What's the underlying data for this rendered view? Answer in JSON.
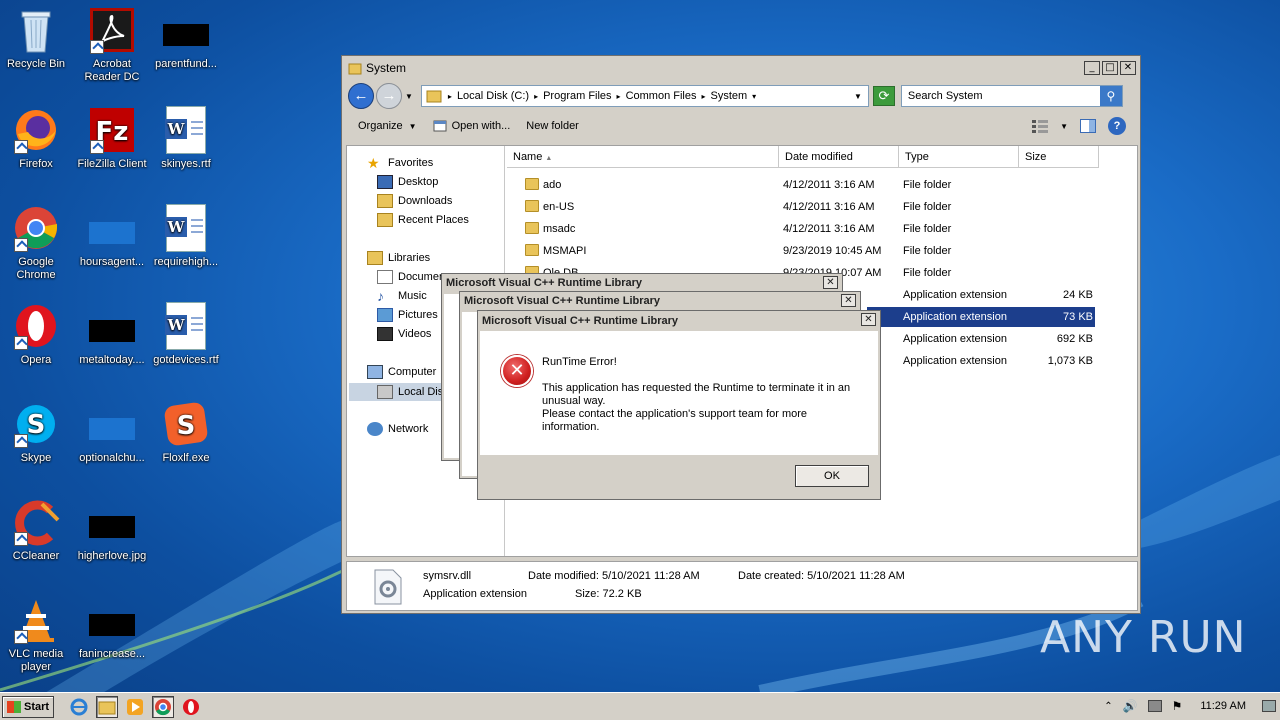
{
  "desktop": {
    "icons": [
      {
        "label": "Recycle Bin"
      },
      {
        "label": "Acrobat Reader DC"
      },
      {
        "label": "parentfund..."
      },
      {
        "label": "Firefox"
      },
      {
        "label": "FileZilla Client"
      },
      {
        "label": "skinyes.rtf"
      },
      {
        "label": "Google Chrome"
      },
      {
        "label": "hoursagent..."
      },
      {
        "label": "requirehigh..."
      },
      {
        "label": "Opera"
      },
      {
        "label": "metaltoday...."
      },
      {
        "label": "gotdevices.rtf"
      },
      {
        "label": "Skype"
      },
      {
        "label": "optionalchu..."
      },
      {
        "label": "Floxlf.exe"
      },
      {
        "label": "CCleaner"
      },
      {
        "label": "higherlove.jpg"
      },
      {
        "label": "VLC media player"
      },
      {
        "label": "fanincrease..."
      }
    ]
  },
  "explorer": {
    "title": "System",
    "breadcrumb": [
      "Local Disk (C:)",
      "Program Files",
      "Common Files",
      "System"
    ],
    "search_placeholder": "Search System",
    "toolbar": {
      "organize": "Organize",
      "open_with": "Open with...",
      "new_folder": "New folder"
    },
    "nav": {
      "favorites": "Favorites",
      "desktop": "Desktop",
      "downloads": "Downloads",
      "recent": "Recent Places",
      "libraries": "Libraries",
      "documents": "Documen",
      "music": "Music",
      "pictures": "Pictures",
      "videos": "Videos",
      "computer": "Computer",
      "local_disk": "Local Disk",
      "network": "Network"
    },
    "columns": {
      "name": "Name",
      "date": "Date modified",
      "type": "Type",
      "size": "Size"
    },
    "rows": [
      {
        "name": "ado",
        "date": "4/12/2011 3:16 AM",
        "type": "File folder",
        "size": ""
      },
      {
        "name": "en-US",
        "date": "4/12/2011 3:16 AM",
        "type": "File folder",
        "size": ""
      },
      {
        "name": "msadc",
        "date": "4/12/2011 3:16 AM",
        "type": "File folder",
        "size": ""
      },
      {
        "name": "MSMAPI",
        "date": "9/23/2019 10:45 AM",
        "type": "File folder",
        "size": ""
      },
      {
        "name": "Ole DB",
        "date": "9/23/2019 10:07 AM",
        "type": "File folder",
        "size": ""
      },
      {
        "name": "",
        "date": "",
        "type": "Application extension",
        "size": "24 KB"
      },
      {
        "name": "",
        "date": "",
        "type": "Application extension",
        "size": "73 KB"
      },
      {
        "name": "",
        "date": "",
        "type": "Application extension",
        "size": "692 KB"
      },
      {
        "name": "",
        "date": "",
        "type": "Application extension",
        "size": "1,073 KB"
      }
    ],
    "details": {
      "filename": "symsrv.dll",
      "filetype": "Application extension",
      "date_modified": "Date modified: 5/10/2021 11:28 AM",
      "date_created": "Date created: 5/10/2021 11:28 AM",
      "size": "Size: 72.2 KB"
    }
  },
  "dialog": {
    "title": "Microsoft Visual C++ Runtime Library",
    "heading": "RunTime Error!",
    "line1": "This application has requested the Runtime to terminate it in an",
    "line2": "unusual way.",
    "line3": "Please contact the application's support team for more",
    "line4": "information.",
    "ok": "OK"
  },
  "taskbar": {
    "start": "Start",
    "clock": "11:29 AM"
  },
  "watermark": "ANY RUN"
}
